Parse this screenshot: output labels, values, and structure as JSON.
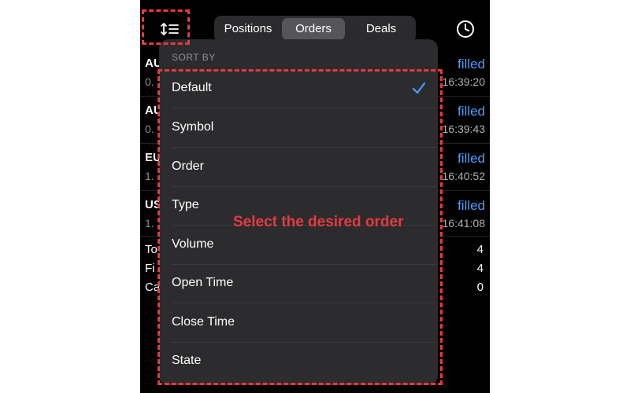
{
  "header": {
    "tabs": [
      {
        "label": "Positions"
      },
      {
        "label": "Orders"
      },
      {
        "label": "Deals"
      }
    ],
    "active_tab": "Orders",
    "sort_icon": "sort-icon",
    "history_icon": "clock-icon"
  },
  "orders": [
    {
      "symbol": "AU",
      "sub": "0.",
      "state": "filled",
      "time": "16:39:20"
    },
    {
      "symbol": "AU",
      "sub": "0.",
      "state": "filled",
      "time": "16:39:43"
    },
    {
      "symbol": "EU",
      "sub": "1.",
      "state": "filled",
      "time": "16:40:52"
    },
    {
      "symbol": "US",
      "sub": "1.",
      "state": "filled",
      "time": "16:41:08"
    }
  ],
  "summary": [
    {
      "label": "To",
      "value": "4"
    },
    {
      "label": "Fi",
      "value": "4"
    },
    {
      "label": "Ca",
      "value": "0"
    }
  ],
  "sort_menu": {
    "header": "SORT BY",
    "items": [
      {
        "label": "Default",
        "selected": true
      },
      {
        "label": "Symbol",
        "selected": false
      },
      {
        "label": "Order",
        "selected": false
      },
      {
        "label": "Type",
        "selected": false
      },
      {
        "label": "Volume",
        "selected": false
      },
      {
        "label": "Open Time",
        "selected": false
      },
      {
        "label": "Close Time",
        "selected": false
      },
      {
        "label": "State",
        "selected": false
      }
    ]
  },
  "annotation": {
    "text": "Select the desired order"
  },
  "colors": {
    "accent": "#4a9eff",
    "highlight": "#e8393f"
  }
}
